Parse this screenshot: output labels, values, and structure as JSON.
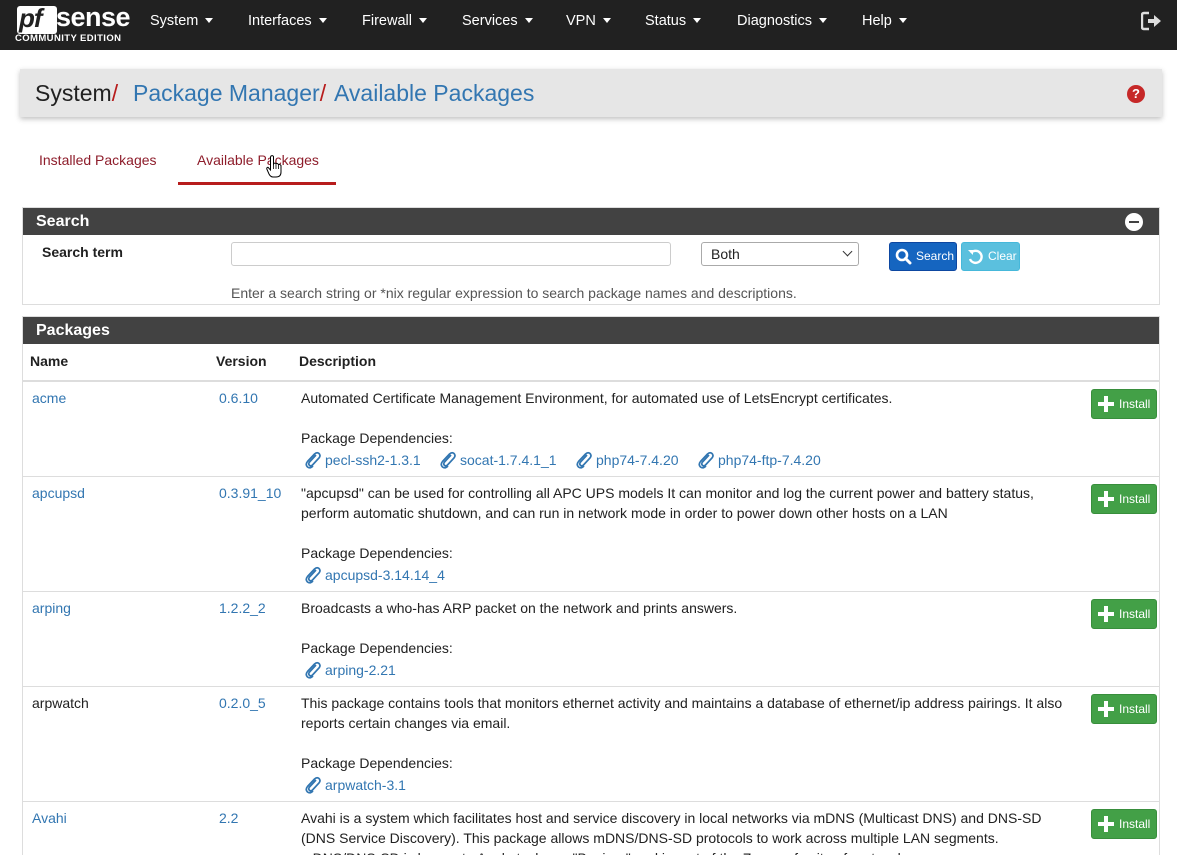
{
  "brand": {
    "logo_part1": "pf",
    "logo_part2": "sense",
    "edition": "COMMUNITY EDITION"
  },
  "nav": {
    "items": [
      "System",
      "Interfaces",
      "Firewall",
      "Services",
      "VPN",
      "Status",
      "Diagnostics",
      "Help"
    ],
    "logout_icon": "sign-out-icon"
  },
  "breadcrumb": {
    "root": "System",
    "level1": "Package Manager",
    "level2": "Available Packages",
    "separator": "/",
    "help_icon": "question-circle-icon"
  },
  "tabs": {
    "installed": "Installed Packages",
    "available": "Available Packages",
    "active": "available"
  },
  "search_panel": {
    "title": "Search",
    "term_label": "Search term",
    "term_value": "",
    "scope_selected": "Both",
    "search_button": "Search",
    "clear_button": "Clear",
    "help": "Enter a search string or *nix regular expression to search package names and descriptions."
  },
  "packages_panel": {
    "title": "Packages",
    "columns": [
      "Name",
      "Version",
      "Description"
    ],
    "deps_label": "Package Dependencies:",
    "install_label": "Install",
    "rows": [
      {
        "name": "acme",
        "version": "0.6.10",
        "description": "Automated Certificate Management Environment, for automated use of LetsEncrypt certificates.",
        "deps": [
          "pecl-ssh2-1.3.1",
          "socat-1.7.4.1_1",
          "php74-7.4.20",
          "php74-ftp-7.4.20"
        ]
      },
      {
        "name": "apcupsd",
        "version": "0.3.91_10",
        "description": "\"apcupsd\" can be used for controlling all APC UPS models It can monitor and log the current power and battery status, perform automatic shutdown, and can run in network mode in order to power down other hosts on a LAN",
        "deps": [
          "apcupsd-3.14.14_4"
        ]
      },
      {
        "name": "arping",
        "version": "1.2.2_2",
        "description": "Broadcasts a who-has ARP packet on the network and prints answers.",
        "deps": [
          "arping-2.21"
        ]
      },
      {
        "name": "arpwatch",
        "version": "0.2.0_5",
        "description": "This package contains tools that monitors ethernet activity and maintains a database of ethernet/ip address pairings. It also reports certain changes via email.",
        "deps": [
          "arpwatch-3.1"
        ]
      },
      {
        "name": "Avahi",
        "version": "2.2",
        "description": "Avahi is a system which facilitates host and service discovery in local networks via mDNS (Multicast DNS) and DNS-SD (DNS Service Discovery). This package allows mDNS/DNS-SD protocols to work across multiple LAN segments. mDNS/DNS-SD is known to Apple techs as \"Bonjour\" and is part of the Zeroconf suite of protocols."
      }
    ]
  },
  "colors": {
    "navbar": "#212121",
    "link": "#3276b1",
    "accent_red": "#b71c1c",
    "install_green": "#43a047",
    "search_blue": "#1565c0",
    "clear_cyan": "#5bc0de"
  }
}
